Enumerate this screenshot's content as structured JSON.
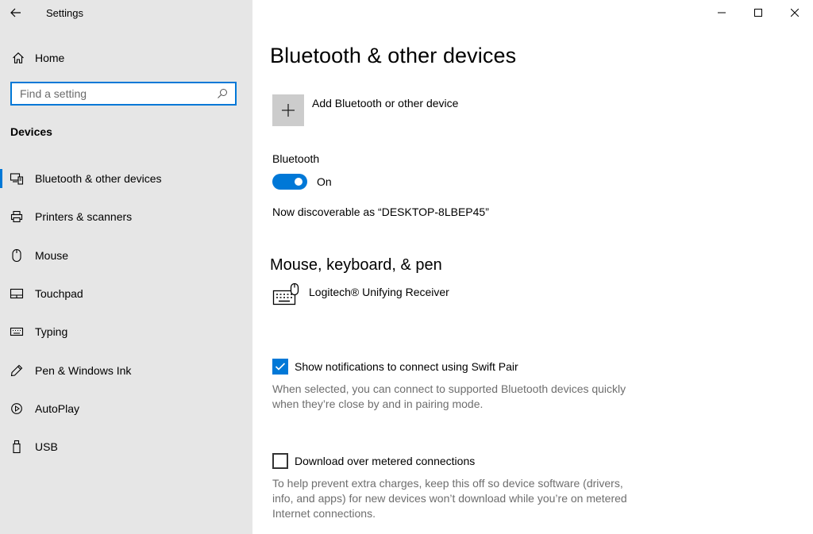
{
  "window": {
    "title": "Settings",
    "controls": [
      "minimize",
      "maximize",
      "close"
    ]
  },
  "sidebar": {
    "home_label": "Home",
    "search_placeholder": "Find a setting",
    "section_title": "Devices",
    "items": [
      {
        "label": "Bluetooth & other devices",
        "icon": "bluetooth-devices-icon",
        "active": true
      },
      {
        "label": "Printers & scanners",
        "icon": "printer-icon",
        "active": false
      },
      {
        "label": "Mouse",
        "icon": "mouse-icon",
        "active": false
      },
      {
        "label": "Touchpad",
        "icon": "touchpad-icon",
        "active": false
      },
      {
        "label": "Typing",
        "icon": "keyboard-icon",
        "active": false
      },
      {
        "label": "Pen & Windows Ink",
        "icon": "pen-icon",
        "active": false
      },
      {
        "label": "AutoPlay",
        "icon": "autoplay-icon",
        "active": false
      },
      {
        "label": "USB",
        "icon": "usb-icon",
        "active": false
      }
    ]
  },
  "main": {
    "title": "Bluetooth & other devices",
    "add_device_label": "Add Bluetooth or other device",
    "bluetooth": {
      "label": "Bluetooth",
      "state_label": "On",
      "enabled": true,
      "discoverable_text": "Now discoverable as “DESKTOP-8LBEP45”"
    },
    "mouse_section": {
      "title": "Mouse, keyboard, & pen",
      "devices": [
        {
          "name": "Logitech® Unifying Receiver",
          "icon": "keyboard-mouse-icon"
        }
      ]
    },
    "swift_pair": {
      "label": "Show notifications to connect using Swift Pair",
      "checked": true,
      "description": "When selected, you can connect to supported Bluetooth devices quickly when they’re close by and in pairing mode."
    },
    "metered": {
      "label": "Download over metered connections",
      "checked": false,
      "description": "To help prevent extra charges, keep this off so device software (drivers, info, and apps) for new devices won’t download while you’re on metered Internet connections."
    }
  },
  "colors": {
    "accent": "#0078d7",
    "sidebar_bg": "#e6e6e6",
    "secondary_text": "#6e6e6e"
  }
}
